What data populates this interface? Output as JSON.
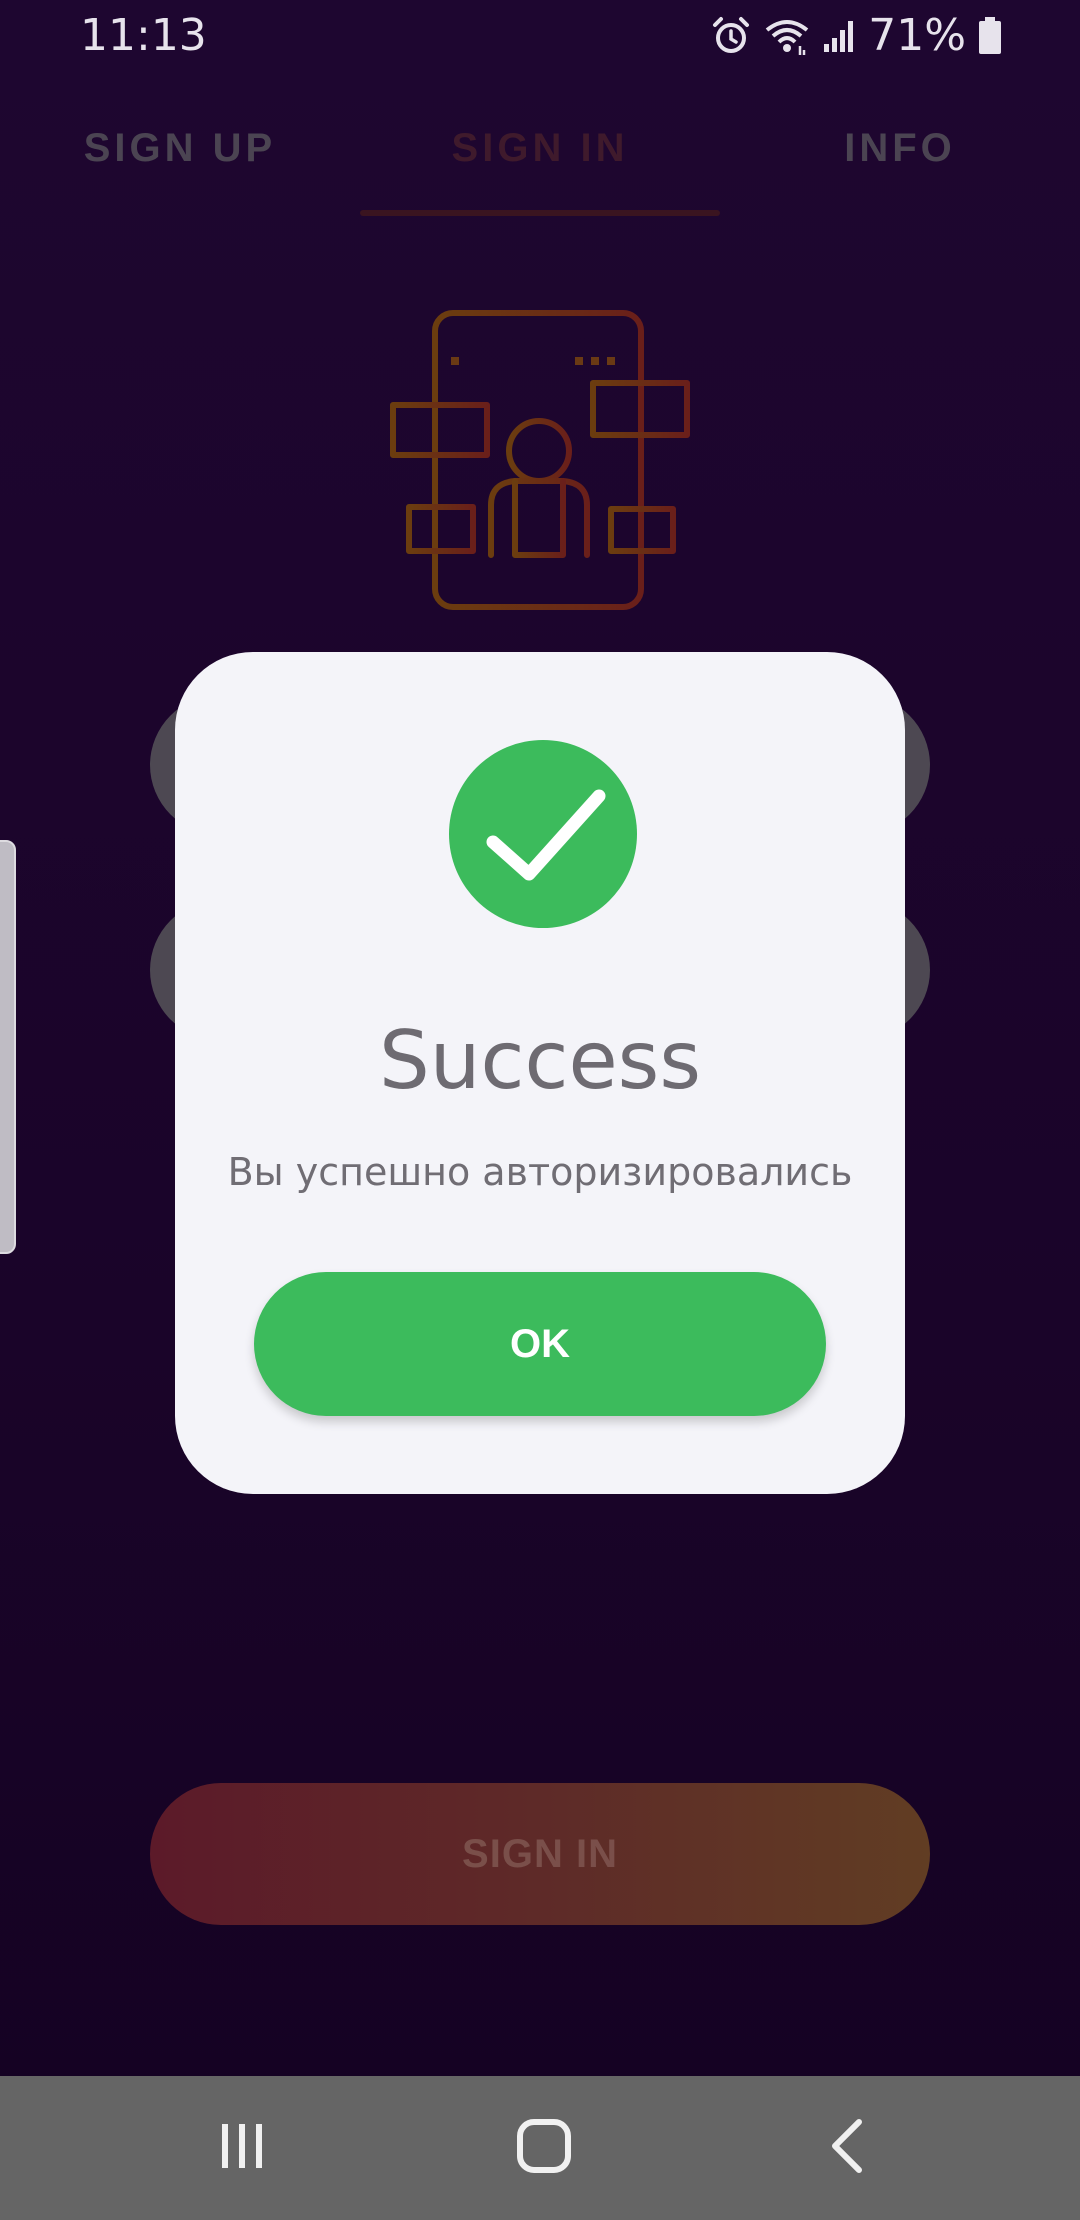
{
  "status_bar": {
    "time": "11:13",
    "battery_percent": "71%",
    "icons": [
      "alarm-icon",
      "wifi-icon",
      "signal-icon",
      "battery-icon"
    ]
  },
  "tabs": [
    {
      "label": "SIGN UP",
      "active": false
    },
    {
      "label": "SIGN IN",
      "active": true
    },
    {
      "label": "INFO",
      "active": false
    }
  ],
  "illustration": {
    "icon": "phone-user-icon",
    "color_start": "#6b3d0f",
    "color_end": "#6a1f1a"
  },
  "form": {
    "signin_button_label": "SIGN IN"
  },
  "dialog": {
    "icon": "check-icon",
    "title": "Success",
    "message": "Вы успешно авторизировались",
    "ok_label": "OK",
    "accent_color": "#3cbb5c"
  },
  "nav_bar": {
    "icons": [
      "recents-icon",
      "home-icon",
      "back-icon"
    ]
  }
}
